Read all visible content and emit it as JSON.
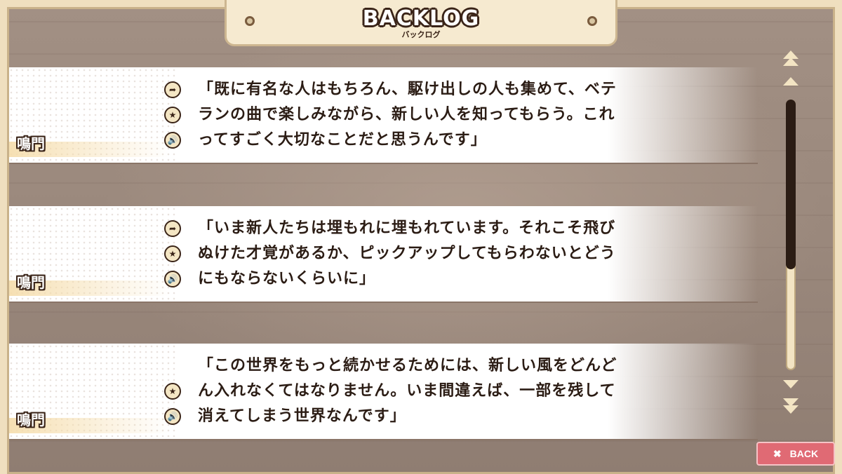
{
  "header": {
    "title": "BACKLOG",
    "subtitle": "バックログ"
  },
  "entries": [
    {
      "speaker": "鳴門",
      "lines": [
        "「既に有名な人はもちろん、駆け出しの人も集めて、ベテ",
        "ランの曲で楽しみながら、新しい人を知ってもらう。これ",
        "ってすごく大切なことだと思うんです」"
      ]
    },
    {
      "speaker": "鳴門",
      "lines": [
        "「いま新人たちは埋もれに埋もれています。それこそ飛び",
        "ぬけた才覚があるか、ピックアップしてもらわないとどう",
        "にもならないくらいに」"
      ]
    },
    {
      "speaker": "鳴門",
      "lines": [
        "「この世界をもっと続かせるためには、新しい風をどんど",
        "ん入れなくてはなりません。いま間違えば、一部を残して",
        "消えてしまう世界なんです」"
      ]
    }
  ],
  "icons": {
    "jump": "jump-arrow-icon",
    "favorite": "star-icon",
    "voice": "speaker-voice-icon"
  },
  "back_button": {
    "icon": "close-icon",
    "label": "BACK"
  },
  "colors": {
    "frame": "#efdfbf",
    "back_button": "#e06a74",
    "text": "#2b1c14"
  }
}
